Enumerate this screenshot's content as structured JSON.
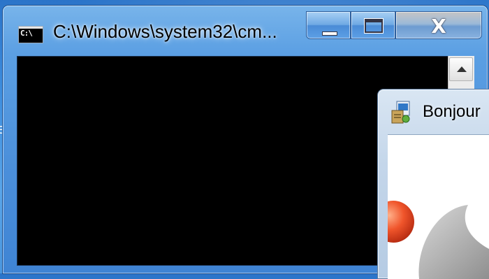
{
  "desktop": {
    "edge_text": "e"
  },
  "cmd_window": {
    "title": "C:\\Windows\\system32\\cm...",
    "icon": "cmd-prompt-icon",
    "icon_text": "C:\\",
    "buttons": {
      "minimize": "minimize-icon",
      "maximize": "maximize-icon",
      "close": "close-icon",
      "close_glyph": "X"
    },
    "console_background": "#000000"
  },
  "bonjour_window": {
    "title": "Bonjour",
    "icon": "installer-icon"
  }
}
